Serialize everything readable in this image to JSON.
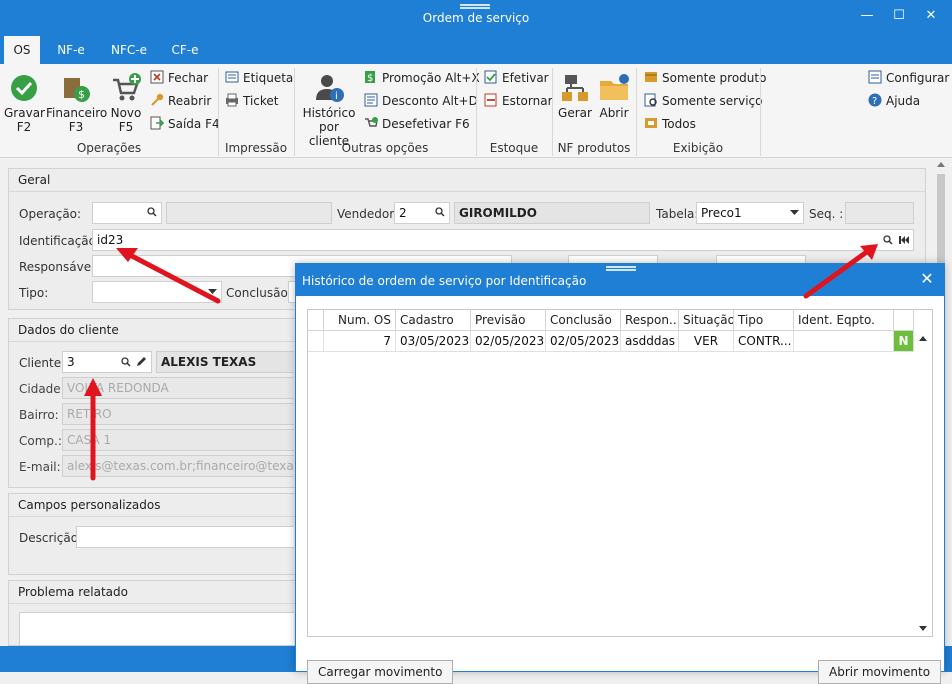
{
  "window": {
    "title": "Ordem de serviço"
  },
  "tabs": [
    "OS",
    "NF-e",
    "NFC-e",
    "CF-e"
  ],
  "ribbon": {
    "operacoes": {
      "label": "Operações",
      "gravar": [
        "Gravar",
        "F2"
      ],
      "financeiro": [
        "Financeiro",
        "F3"
      ],
      "novo": [
        "Novo",
        "F5"
      ],
      "fechar": "Fechar",
      "reabrir": "Reabrir",
      "saida": "Saída F4"
    },
    "impressao": {
      "label": "Impressão",
      "etiqueta": "Etiqueta",
      "ticket": "Ticket"
    },
    "outras": {
      "label": "Outras opções",
      "historico": [
        "Histórico",
        "por cliente"
      ],
      "promocao": "Promoção Alt+X",
      "desconto": "Desconto Alt+D",
      "desefetivar": "Desefetivar F6"
    },
    "estoque": {
      "label": "Estoque",
      "efetivar": "Efetivar",
      "estornar": "Estornar"
    },
    "nf_produtos": {
      "label": "NF produtos",
      "gerar": "Gerar",
      "abrir": "Abrir"
    },
    "exibicao": {
      "label": "Exibição",
      "somente_produto": "Somente produto",
      "somente_servico": "Somente serviço",
      "todos": "Todos"
    },
    "extra": {
      "configurar": "Configurar",
      "ajuda": "Ajuda"
    }
  },
  "geral": {
    "title": "Geral",
    "operacao_label": "Operação:",
    "operacao_value": "",
    "vendedor_label": "Vendedor:",
    "vendedor_code": "2",
    "vendedor_name": "GIROMILDO",
    "tabela_label": "Tabela:",
    "tabela_value": "Preco1",
    "seq_label": "Seq. :",
    "identificacao_label": "Identificação:",
    "identificacao_value": "id23",
    "responsavel_label": "Responsável:",
    "tipo_label": "Tipo:",
    "conclusao_label": "Conclusão:"
  },
  "cliente": {
    "title": "Dados do cliente",
    "cliente_label": "Cliente:",
    "cliente_code": "3",
    "cliente_name": "ALEXIS TEXAS",
    "cidade_label": "Cidade:",
    "cidade_value": "VOLTA REDONDA",
    "bairro_label": "Bairro:",
    "bairro_value": "RETIRO",
    "comp_label": "Comp.:",
    "comp_value": "CASA 1",
    "email_label": "E-mail:",
    "email_value": "alexis@texas.com.br;financeiro@texas.com.br"
  },
  "campos": {
    "title": "Campos personalizados",
    "descricao_label": "Descrição:"
  },
  "problema": {
    "title": "Problema relatado"
  },
  "dialog": {
    "title": "Histórico de ordem de serviço por Identificação",
    "columns": [
      "Num. OS",
      "Cadastro",
      "Previsão",
      "Conclusão",
      "Respon...",
      "Situação",
      "Tipo",
      "Ident. Eqpto."
    ],
    "rows": [
      {
        "num_os": "7",
        "cadastro": "03/05/2023",
        "previsao": "02/05/2023",
        "conclusao": "02/05/2023",
        "responsavel": "asdddas",
        "situacao": "VER",
        "tipo": "CONTR...",
        "ident": "",
        "flag": "N"
      }
    ],
    "btn_carregar": "Carregar movimento",
    "btn_abrir": "Abrir movimento"
  },
  "colors": {
    "accent": "#1f7fd4",
    "arrow": "#e0141e",
    "flag_green": "#6cbf3a"
  }
}
